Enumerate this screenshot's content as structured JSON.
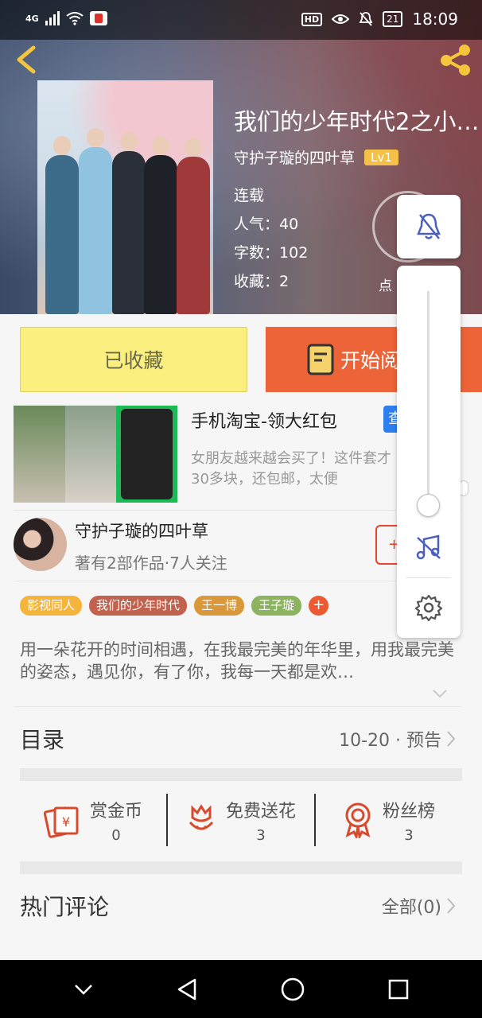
{
  "status_bar": {
    "network": "4G",
    "time": "18:09",
    "hd": "HD",
    "battery": "21"
  },
  "book": {
    "title": "我们的少年时代2之小…",
    "author": "守护子璇的四叶草",
    "level": "Lv1",
    "status": "连载",
    "popularity_label": "人气：",
    "popularity": "40",
    "words_label": "字数：",
    "words": "102",
    "favorites_label": "收藏：",
    "favorites": "2",
    "rate_label": "点"
  },
  "actions": {
    "collected_label": "已收藏",
    "read_label": "开始阅"
  },
  "ad": {
    "title": "手机淘宝-领大红包",
    "tag": "查",
    "desc": "女朋友越来越会买了！这件套才30多块，还包邮，太便"
  },
  "author_card": {
    "name": "守护子璇的四叶草",
    "stats": "著有2部作品·7人关注",
    "follow_label": "+"
  },
  "tags": [
    {
      "label": "影视同人",
      "color": "#f5b43c"
    },
    {
      "label": "我们的少年时代",
      "color": "#c0624e"
    },
    {
      "label": "王一博",
      "color": "#d9983a"
    },
    {
      "label": "王子璇",
      "color": "#8cb360"
    }
  ],
  "tag_plus": "+",
  "intro": "用一朵花开的时间相遇，在我最完美的年华里，用我最完美的姿态，遇见你，有了你，我每一天都是欢…",
  "catalog": {
    "title": "目录",
    "info": "10-20 · 预告"
  },
  "stats": [
    {
      "label": "赏金币",
      "value": "0",
      "icon": "coin-envelope-icon"
    },
    {
      "label": "免费送花",
      "value": "3",
      "icon": "flower-icon"
    },
    {
      "label": "粉丝榜",
      "value": "3",
      "icon": "ribbon-medal-icon"
    }
  ],
  "comments": {
    "title": "热门评论",
    "all_label": "全部(0)"
  },
  "colors": {
    "accent_orange": "#ec6437",
    "collected_yellow": "#fbef80",
    "icon_red": "#d84a2e",
    "panel_icon_blue": "#4a5fc0"
  }
}
